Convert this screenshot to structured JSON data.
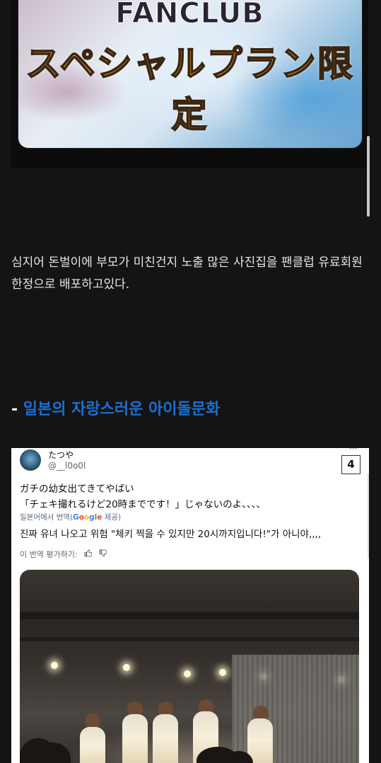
{
  "top_image": {
    "line1": "FANCLUB",
    "line2": "スペシャルプラン限定"
  },
  "post": {
    "paragraph": "심지어 돈벌이에 부모가 미친건지 노출 많은 사진집을 팬클럽 유료회원 한정으로 배포하고있다.",
    "heading_prefix": "- ",
    "heading_accent": "일본의 자랑스러운 아이돌문화"
  },
  "tweet": {
    "display_name": "たつや",
    "handle": "@__l0o0l",
    "more": "···",
    "badge": "4",
    "jp_line1": "ガチの幼女出てきてやばい",
    "jp_line2": "「チェキ撮れるけど20時までです！」じゃないのよ、、、、",
    "translated_prefix": "일본어에서 번역(",
    "translated_suffix": " 제공)",
    "ko_translation": "진짜 유녀 나오고 위험 \"체키 찍을 수 있지만 20시까지입니다!\"가 아니야,,,,",
    "rate_label": "이 번역 평가하기:",
    "thumbs_up_icon": "thumbs-up-icon",
    "thumbs_down_icon": "thumbs-down-icon"
  },
  "colors": {
    "background": "#141414",
    "accent": "#1c6fd1"
  }
}
